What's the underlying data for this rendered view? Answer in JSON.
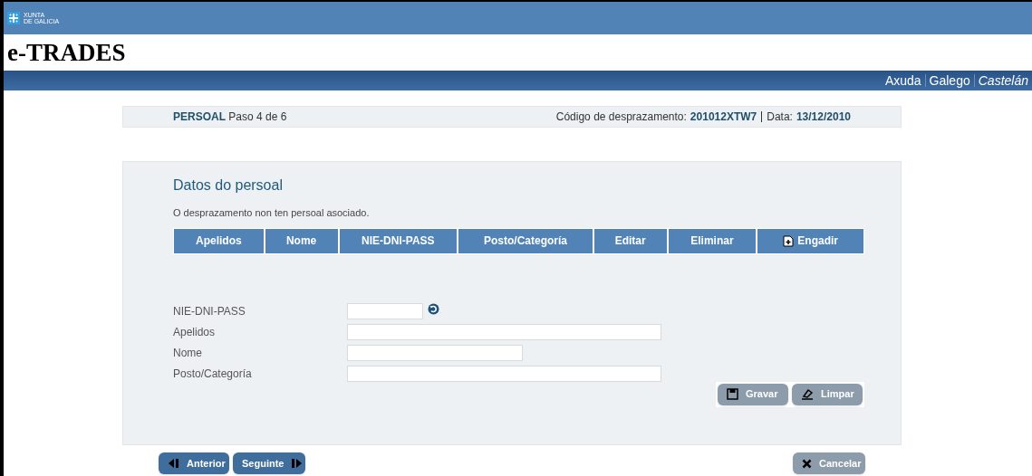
{
  "logo": {
    "text": [
      "XUNTA",
      "DE GALICIA"
    ]
  },
  "app_title": "e-TRADES",
  "top_links": [
    {
      "label": "Axuda",
      "selected": false
    },
    {
      "label": "Galego",
      "selected": false
    },
    {
      "label": "Castelán",
      "selected": true
    }
  ],
  "step_bar": {
    "section": "PERSOAL",
    "step": "Paso 4 de 6",
    "code_label": "Código de desprazamento:",
    "code": "201012XTW7",
    "date_label": "Data:",
    "date": "13/12/2010"
  },
  "panel": {
    "title": "Datos do persoal",
    "message": "O desprazamento non ten persoal asociado.",
    "table": {
      "columns": [
        {
          "label": "Apelidos",
          "kind": "text"
        },
        {
          "label": "Nome",
          "kind": "text"
        },
        {
          "label": "NIE-DNI-PASS",
          "kind": "text"
        },
        {
          "label": "Posto/Categoría",
          "kind": "text"
        },
        {
          "label": "Editar",
          "kind": "text"
        },
        {
          "label": "Eliminar",
          "kind": "text"
        },
        {
          "label": "Engadir",
          "kind": "add"
        }
      ]
    },
    "fields": [
      {
        "label": "NIE-DNI-PASS",
        "kind": "lookup"
      },
      {
        "label": "Apelidos",
        "kind": "long"
      },
      {
        "label": "Nome",
        "kind": "medium"
      },
      {
        "label": "Posto/Categoría",
        "kind": "long"
      }
    ],
    "buttons": [
      {
        "label": "Gravar",
        "kind": "save",
        "disabled": true
      },
      {
        "label": "Limpar",
        "kind": "clear",
        "disabled": true
      }
    ]
  },
  "nav_buttons": [
    {
      "label": "Anterior",
      "kind": "previous",
      "disabled": false
    },
    {
      "label": "Seguinte",
      "kind": "next",
      "disabled": false
    },
    {
      "label": "Cancelar",
      "kind": "cancel",
      "disabled": true
    }
  ]
}
